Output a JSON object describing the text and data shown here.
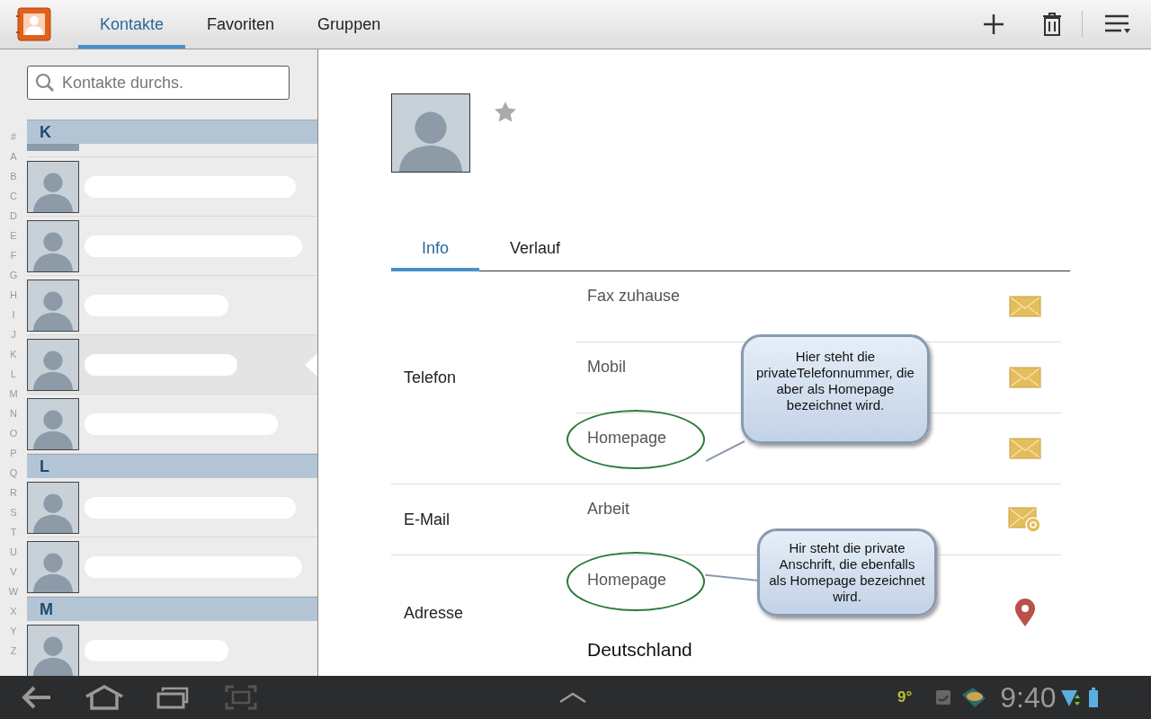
{
  "app_bar": {
    "tabs": [
      {
        "label": "Kontakte",
        "selected": true
      },
      {
        "label": "Favoriten",
        "selected": false
      },
      {
        "label": "Gruppen",
        "selected": false
      }
    ]
  },
  "search": {
    "placeholder": "Kontakte durchs."
  },
  "index_letters": [
    "#",
    "A",
    "B",
    "C",
    "D",
    "E",
    "F",
    "G",
    "H",
    "I",
    "J",
    "K",
    "L",
    "M",
    "N",
    "O",
    "P",
    "Q",
    "R",
    "S",
    "T",
    "U",
    "V",
    "W",
    "X",
    "Y",
    "Z"
  ],
  "contact_list": [
    {
      "kind": "header",
      "label": "K"
    },
    {
      "kind": "contact",
      "selected": false
    },
    {
      "kind": "contact",
      "selected": false
    },
    {
      "kind": "contact",
      "selected": false
    },
    {
      "kind": "contact",
      "selected": true
    },
    {
      "kind": "contact",
      "selected": false
    },
    {
      "kind": "header",
      "label": "L"
    },
    {
      "kind": "contact",
      "selected": false
    },
    {
      "kind": "contact",
      "selected": false
    },
    {
      "kind": "header",
      "label": "M"
    },
    {
      "kind": "contact",
      "selected": false
    }
  ],
  "detail": {
    "favorite": false,
    "tabs": [
      {
        "label": "Info",
        "selected": true
      },
      {
        "label": "Verlauf",
        "selected": false
      }
    ],
    "sections": [
      {
        "label": "Telefon",
        "entries": [
          {
            "type": "Fax zuhause",
            "kind": "message",
            "circled": false
          },
          {
            "type": "Mobil",
            "kind": "message",
            "circled": false
          },
          {
            "type": "Homepage",
            "kind": "message",
            "circled": true
          }
        ]
      },
      {
        "label": "E-Mail",
        "entries": [
          {
            "type": "Arbeit",
            "kind": "email",
            "circled": false
          }
        ]
      },
      {
        "label": "Adresse",
        "entries": [
          {
            "type": "Homepage",
            "value": "Deutschland",
            "kind": "address",
            "circled": true
          }
        ]
      }
    ]
  },
  "callouts": [
    "Hier steht die privateTelefonnummer, die aber als Homepage bezeichnet wird.",
    "Hir steht die private Anschrift, die ebenfalls als Homepage bezeichnet wird."
  ],
  "status_bar": {
    "temperature": "9°",
    "time": "9:40"
  }
}
